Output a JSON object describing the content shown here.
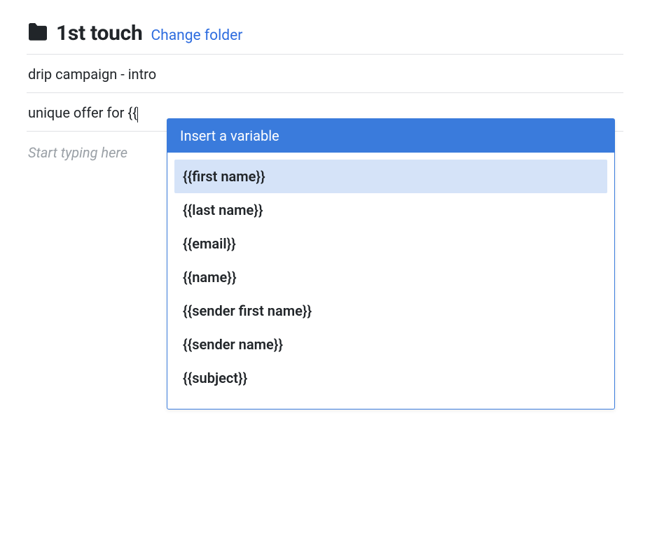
{
  "header": {
    "folder_name": "1st touch",
    "change_folder_label": "Change folder"
  },
  "campaign_name": "drip campaign - intro",
  "subject_line": "unique offer for {{",
  "body_placeholder": "Start typing here",
  "dropdown": {
    "title": "Insert a variable",
    "items": [
      "{{first name}}",
      "{{last name}}",
      "{{email}}",
      "{{name}}",
      "{{sender first name}}",
      "{{sender name}}",
      "{{subject}}"
    ],
    "highlighted_index": 0
  }
}
